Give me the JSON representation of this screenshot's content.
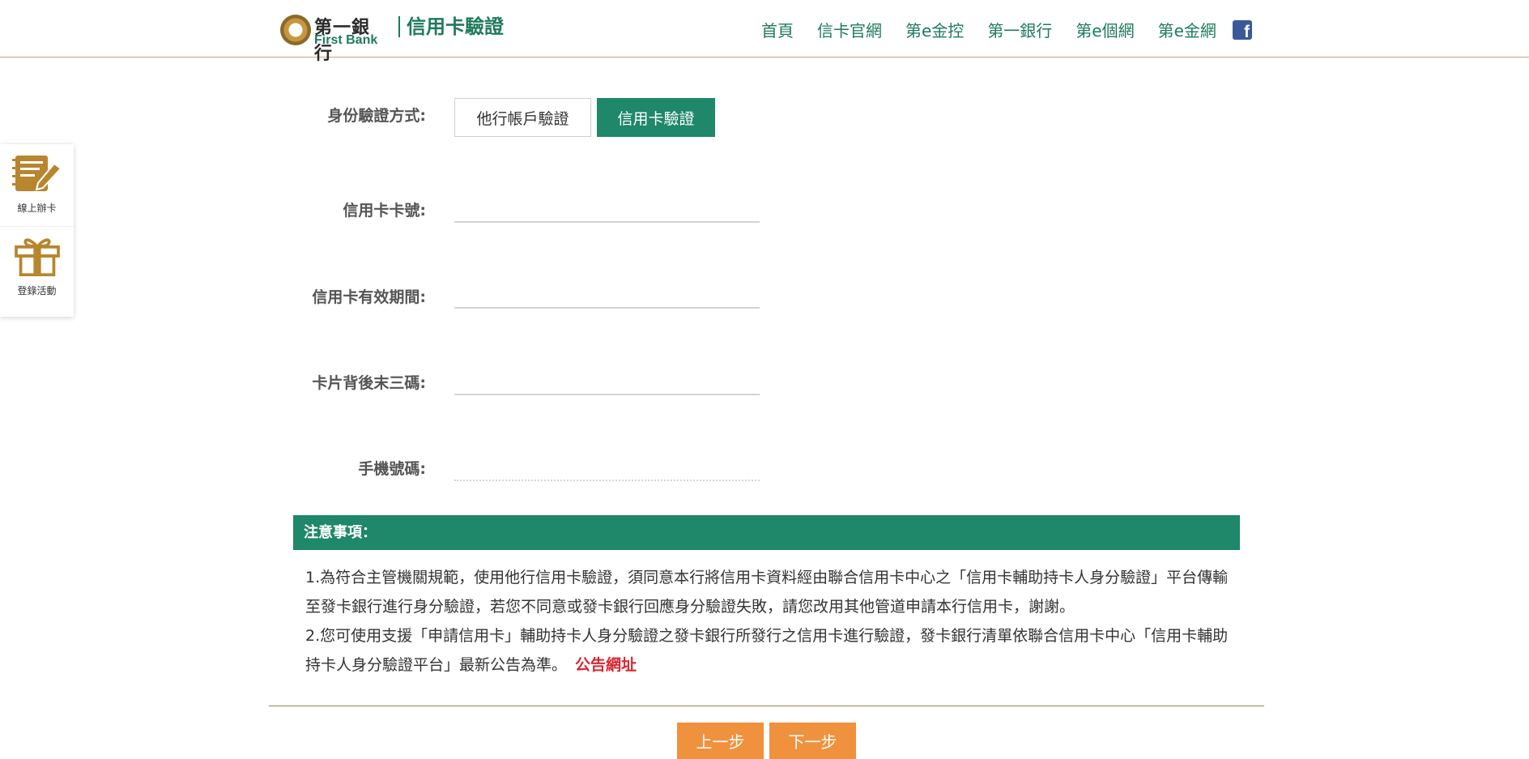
{
  "header": {
    "logo_cn": "第一銀行",
    "logo_en": "First Bank",
    "site_title": "信用卡驗證",
    "nav": [
      "首頁",
      "信卡官網",
      "第e金控",
      "第一銀行",
      "第e個網",
      "第e金網"
    ],
    "facebook_glyph": "f"
  },
  "side_menu": {
    "items": [
      {
        "label": "線上辦卡",
        "icon": "notebook-pen-icon"
      },
      {
        "label": "登錄活動",
        "icon": "gift-icon"
      }
    ]
  },
  "form": {
    "method_label": "身份驗證方式:",
    "tabs": [
      {
        "label": "他行帳戶驗證",
        "active": false
      },
      {
        "label": "信用卡驗證",
        "active": true
      }
    ],
    "card_number_label": "信用卡卡號:",
    "expiry_label": "信用卡有效期間:",
    "cvv_label": "卡片背後末三碼:",
    "mobile_label": "手機號碼:",
    "card_number_value": "",
    "expiry_value": "",
    "cvv_value": "",
    "mobile_value": ""
  },
  "notice": {
    "title": "注意事項：",
    "line1": "1.為符合主管機關規範，使用他行信用卡驗證，須同意本行將信用卡資料經由聯合信用卡中心之「信用卡輔助持卡人身分驗證」平台傳輸至發卡銀行進行身分驗證，若您不同意或發卡銀行回應身分驗證失敗，請您改用其他管道申請本行信用卡，謝謝。",
    "line2": "2.您可使用支援「申請信用卡」輔助持卡人身分驗證之發卡銀行所發行之信用卡進行驗證，發卡銀行清單依聯合信用卡中心「信用卡輔助持卡人身分驗證平台」最新公告為準。",
    "link_label": "公告網址"
  },
  "buttons": {
    "prev": "上一步",
    "next": "下一步"
  },
  "colors": {
    "brand_green": "#1f876a",
    "accent_orange": "#f0913e",
    "link_red": "#d9262f",
    "gold": "#b8862e"
  }
}
